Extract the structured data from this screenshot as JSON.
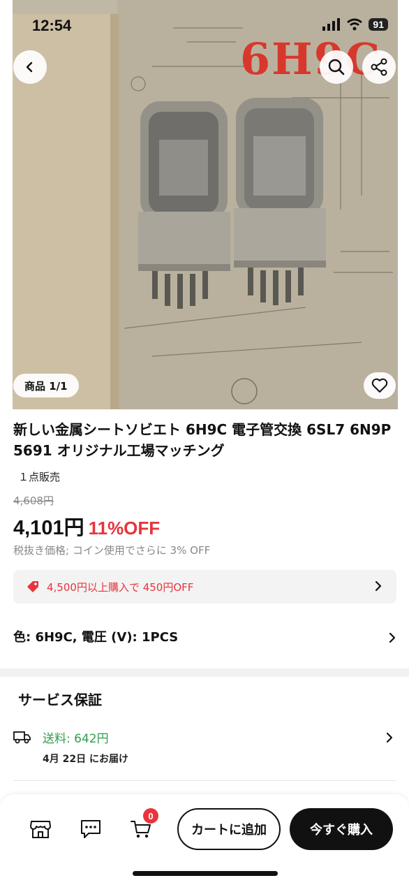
{
  "status_bar": {
    "time": "12:54",
    "battery": "91"
  },
  "hero": {
    "overlay_text": "6H9C",
    "image_counter": "商品 1/1"
  },
  "product": {
    "title": "新しい金属シートソビエト 6H9C 電子管交換 6SL7 6N9P 5691 オリジナル工場マッチング",
    "sold": "１点販売",
    "original_price": "4,608円",
    "price": "4,101円",
    "discount": "11%OFF",
    "tax_note": "税抜き価格; コイン使用でさらに 3% OFF"
  },
  "coupon": {
    "text": "4,500円以上購入で 450円OFF"
  },
  "variant": {
    "text": "色: 6H9C, 電圧 (V): 1PCS"
  },
  "service": {
    "title": "サービス保証",
    "shipping_label": "送料:  642円",
    "delivery_date": "4月 22日 にお届け"
  },
  "bottom_bar": {
    "cart_count": "0",
    "add_to_cart": "カートに追加",
    "buy_now": "今すぐ購入"
  },
  "colors": {
    "accent_red": "#e8343c",
    "shipping_green": "#2f9e4a",
    "buy_button": "#111111"
  },
  "icons": [
    "back-icon",
    "search-icon",
    "share-icon",
    "heart-icon",
    "tag-icon",
    "chevron-right-icon",
    "truck-icon",
    "store-icon",
    "chat-icon",
    "cart-icon"
  ]
}
